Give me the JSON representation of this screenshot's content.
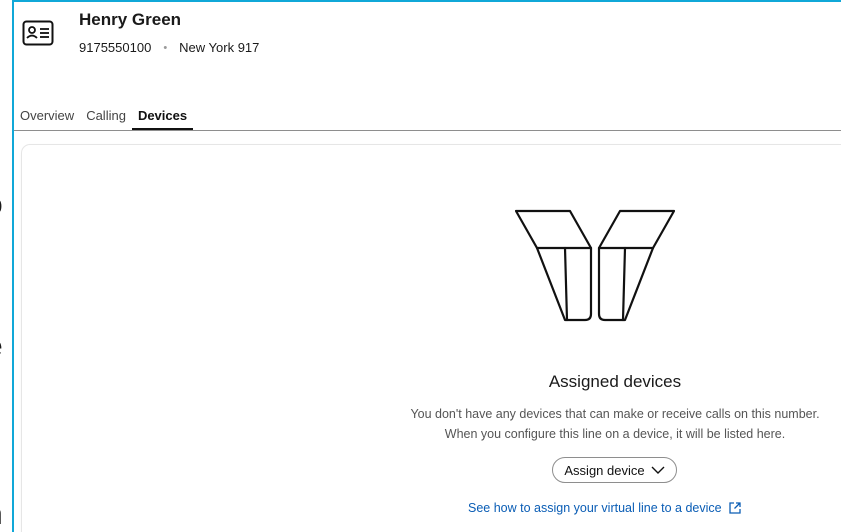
{
  "header": {
    "name": "Henry Green",
    "number": "9175550100",
    "location": "New York 917",
    "separator": "•"
  },
  "tabs": [
    {
      "label": "Overview",
      "active": false
    },
    {
      "label": "Calling",
      "active": false
    },
    {
      "label": "Devices",
      "active": true
    }
  ],
  "empty_state": {
    "title": "Assigned devices",
    "line1": "You don't have any devices that can make or receive calls on this number.",
    "line2": "When you configure this line on a device, it will be listed here.",
    "assign_button": "Assign device",
    "help_link": "See how to assign your virtual line to a device"
  },
  "icons": {
    "contact": "contact-card-icon",
    "devices": "devices-illustration",
    "chevron": "chevron-down-icon",
    "external": "external-link-icon"
  },
  "colors": {
    "accent_border": "#10a8d8",
    "link": "#0a5db5"
  }
}
